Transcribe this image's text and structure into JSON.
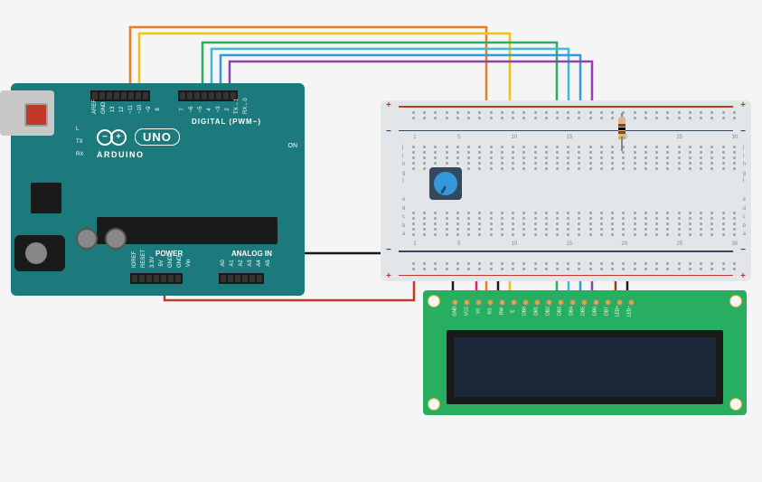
{
  "arduino": {
    "brand": "ARDUINO",
    "model": "UNO",
    "on_label": "ON",
    "side_labels": "L\nTX\nRX",
    "digital_label": "DIGITAL (PWM~)",
    "power_label": "POWER",
    "analog_label": "ANALOG IN",
    "pins_top1": [
      "AREF",
      "GND",
      "13",
      "12",
      "~11",
      "~10",
      "~9",
      "8"
    ],
    "pins_top2": [
      "7",
      "~6",
      "~5",
      "4",
      "~3",
      "2",
      "TX→1",
      "RX←0"
    ],
    "pins_bot1": [
      "IOREF",
      "RESET",
      "3.3V",
      "5V",
      "GND",
      "GND",
      "Vin"
    ],
    "pins_bot2": [
      "A0",
      "A1",
      "A2",
      "A3",
      "A4",
      "A5"
    ]
  },
  "breadboard": {
    "col_numbers": [
      "1",
      "",
      "",
      "",
      "5",
      "",
      "",
      "",
      "",
      "10",
      "",
      "",
      "",
      "",
      "15",
      "",
      "",
      "",
      "",
      "20",
      "",
      "",
      "",
      "",
      "25",
      "",
      "",
      "",
      "",
      "30"
    ],
    "rows_top": [
      "j",
      "i",
      "h",
      "g",
      "f"
    ],
    "rows_bottom": [
      "e",
      "d",
      "c",
      "b",
      "a"
    ],
    "rail_plus": "+",
    "rail_minus": "−"
  },
  "lcd": {
    "pin_labels": [
      "GND",
      "VCC",
      "V0",
      "RS",
      "RW",
      "E",
      "DB0",
      "DB1",
      "DB2",
      "DB3",
      "DB4",
      "DB5",
      "DB6",
      "DB7",
      "LED+",
      "LED−"
    ]
  },
  "components": {
    "potentiometer": "potentiometer-10k",
    "resistor": "resistor-220"
  },
  "wires": [
    {
      "name": "d12-orange",
      "from": "arduino-D12",
      "to": "lcd-rs",
      "color": "#e67e22"
    },
    {
      "name": "d11-yellow",
      "from": "arduino-D11",
      "to": "lcd-e",
      "color": "#f1c40f"
    },
    {
      "name": "d5-green",
      "from": "arduino-D5",
      "to": "lcd-db4",
      "color": "#27ae60"
    },
    {
      "name": "d4-cyan",
      "from": "arduino-D4",
      "to": "lcd-db5",
      "color": "#3bbcd9"
    },
    {
      "name": "d3-blue",
      "from": "arduino-D3",
      "to": "lcd-db6",
      "color": "#3498db"
    },
    {
      "name": "d2-purple",
      "from": "arduino-D2",
      "to": "lcd-db7",
      "color": "#8e44ad"
    },
    {
      "name": "gnd-black",
      "from": "arduino-GND",
      "to": "breadboard-gnd-rail",
      "color": "#2c3e50"
    },
    {
      "name": "5v-red",
      "from": "arduino-5V",
      "to": "breadboard-pwr-rail",
      "color": "#c0392b"
    }
  ]
}
